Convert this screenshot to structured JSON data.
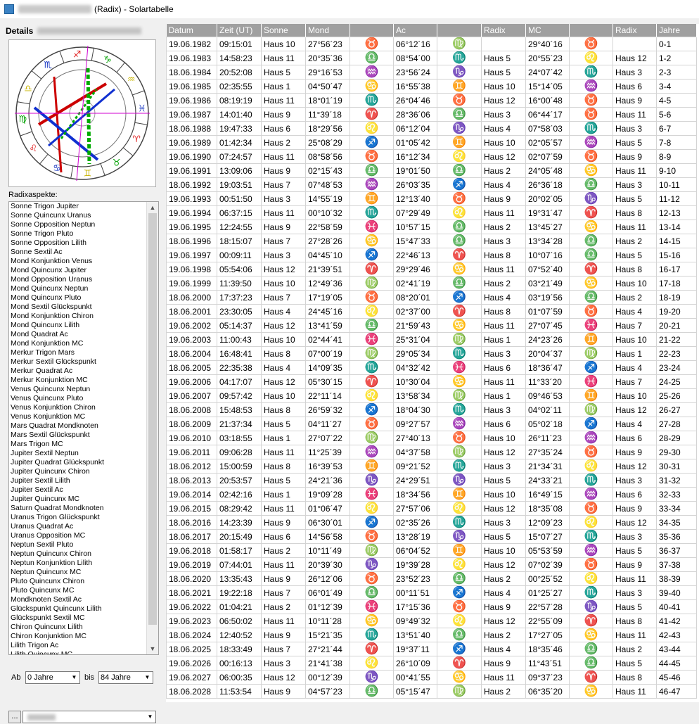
{
  "window": {
    "title": "(Radix) - Solartabelle"
  },
  "left": {
    "details_label": "Details",
    "aspects_label": "Radixaspekte:",
    "aspects": [
      "Sonne Trigon Jupiter",
      "Sonne Quincunx Uranus",
      "Sonne Opposition Neptun",
      "Sonne Trigon Pluto",
      "Sonne Opposition Lilith",
      "Sonne Sextil Ac",
      "Mond Konjunktion Venus",
      "Mond Quincunx Jupiter",
      "Mond Opposition Uranus",
      "Mond Quincunx Neptun",
      "Mond Quincunx Pluto",
      "Mond Sextil Glückspunkt",
      "Mond Konjunktion Chiron",
      "Mond Quincunx Lilith",
      "Mond Quadrat Ac",
      "Mond Konjunktion MC",
      "Merkur Trigon Mars",
      "Merkur Sextil Glückspunkt",
      "Merkur Quadrat Ac",
      "Merkur Konjunktion MC",
      "Venus Quincunx Neptun",
      "Venus Quincunx Pluto",
      "Venus Konjunktion Chiron",
      "Venus Konjunktion MC",
      "Mars Quadrat Mondknoten",
      "Mars Sextil Glückspunkt",
      "Mars Trigon MC",
      "Jupiter Sextil Neptun",
      "Jupiter Quadrat Glückspunkt",
      "Jupiter Quincunx Chiron",
      "Jupiter Sextil Lilith",
      "Jupiter Sextil Ac",
      "Jupiter Quincunx MC",
      "Saturn Quadrat Mondknoten",
      "Uranus Trigon Glückspunkt",
      "Uranus Quadrat Ac",
      "Uranus Opposition MC",
      "Neptun Sextil Pluto",
      "Neptun Quincunx Chiron",
      "Neptun Konjunktion Lilith",
      "Neptun Quincunx MC",
      "Pluto Quincunx Chiron",
      "Pluto Quincunx MC",
      "Mondknoten Sextil Ac",
      "Glückspunkt Quincunx Lilith",
      "Glückspunkt Sextil MC",
      "Chiron Quincunx Lilith",
      "Chiron Konjunktion MC",
      "Lilith Trigon Ac",
      "Lilith Quincunx MC"
    ],
    "range": {
      "from_label": "Ab",
      "from_value": "0 Jahre",
      "to_label": "bis",
      "to_value": "84 Jahre"
    },
    "place_button": "..."
  },
  "colors": {
    "header_bg": "#a0a0a0",
    "fire": "#e02020",
    "earth": "#00a000",
    "air": "#c8b400",
    "water": "#1030c0"
  },
  "table": {
    "columns": [
      "Datum",
      "Zeit (UT)",
      "Sonne",
      "Mond",
      "",
      "Ac",
      "",
      "Radix",
      "MC",
      "",
      "Radix",
      "Jahre"
    ],
    "rows": [
      [
        "19.06.1982",
        "09:15:01",
        "Haus 10",
        "27°56´23",
        "♉",
        "06°12´16",
        "♍",
        "",
        "29°40´16",
        "♉",
        "",
        "0-1"
      ],
      [
        "19.06.1983",
        "14:58:23",
        "Haus 11",
        "20°35´36",
        "♎",
        "08°54´00",
        "♏",
        "Haus 5",
        "20°55´23",
        "♌",
        "Haus 12",
        "1-2"
      ],
      [
        "18.06.1984",
        "20:52:08",
        "Haus 5",
        "29°16´53",
        "♒",
        "23°56´24",
        "♑",
        "Haus 5",
        "24°07´42",
        "♏",
        "Haus 3",
        "2-3"
      ],
      [
        "19.06.1985",
        "02:35:55",
        "Haus 1",
        "04°50´47",
        "♋",
        "16°55´38",
        "♊",
        "Haus 10",
        "15°14´05",
        "♒",
        "Haus 6",
        "3-4"
      ],
      [
        "19.06.1986",
        "08:19:19",
        "Haus 11",
        "18°01´19",
        "♏",
        "26°04´46",
        "♉",
        "Haus 12",
        "16°00´48",
        "♉",
        "Haus 9",
        "4-5"
      ],
      [
        "19.06.1987",
        "14:01:40",
        "Haus 9",
        "11°39´18",
        "♈",
        "28°36´06",
        "♎",
        "Haus 3",
        "06°44´17",
        "♉",
        "Haus 11",
        "5-6"
      ],
      [
        "18.06.1988",
        "19:47:33",
        "Haus 6",
        "18°29´56",
        "♌",
        "06°12´04",
        "♑",
        "Haus 4",
        "07°58´03",
        "♏",
        "Haus 3",
        "6-7"
      ],
      [
        "19.06.1989",
        "01:42:34",
        "Haus 2",
        "25°08´29",
        "♐",
        "01°05´42",
        "♊",
        "Haus 10",
        "02°05´57",
        "♒",
        "Haus 5",
        "7-8"
      ],
      [
        "19.06.1990",
        "07:24:57",
        "Haus 11",
        "08°58´56",
        "♉",
        "16°12´34",
        "♌",
        "Haus 12",
        "02°07´59",
        "♉",
        "Haus 9",
        "8-9"
      ],
      [
        "19.06.1991",
        "13:09:06",
        "Haus 9",
        "02°15´43",
        "♎",
        "19°01´50",
        "♎",
        "Haus 2",
        "24°05´48",
        "♋",
        "Haus 11",
        "9-10"
      ],
      [
        "18.06.1992",
        "19:03:51",
        "Haus 7",
        "07°48´53",
        "♒",
        "26°03´35",
        "♐",
        "Haus 4",
        "26°36´18",
        "♎",
        "Haus 3",
        "10-11"
      ],
      [
        "19.06.1993",
        "00:51:50",
        "Haus 3",
        "14°55´19",
        "♊",
        "12°13´40",
        "♉",
        "Haus 9",
        "20°02´05",
        "♑",
        "Haus 5",
        "11-12"
      ],
      [
        "19.06.1994",
        "06:37:15",
        "Haus 11",
        "00°10´32",
        "♏",
        "07°29´49",
        "♌",
        "Haus 11",
        "19°31´47",
        "♈",
        "Haus 8",
        "12-13"
      ],
      [
        "19.06.1995",
        "12:24:55",
        "Haus 9",
        "22°58´59",
        "♓",
        "10°57´15",
        "♎",
        "Haus 2",
        "13°45´27",
        "♋",
        "Haus 11",
        "13-14"
      ],
      [
        "18.06.1996",
        "18:15:07",
        "Haus 7",
        "27°28´26",
        "♋",
        "15°47´33",
        "♎",
        "Haus 3",
        "13°34´28",
        "♎",
        "Haus 2",
        "14-15"
      ],
      [
        "19.06.1997",
        "00:09:11",
        "Haus 3",
        "04°45´10",
        "♐",
        "22°46´13",
        "♈",
        "Haus 8",
        "10°07´16",
        "♎",
        "Haus 5",
        "15-16"
      ],
      [
        "19.06.1998",
        "05:54:06",
        "Haus 12",
        "21°39´51",
        "♈",
        "29°29´46",
        "♋",
        "Haus 11",
        "07°52´40",
        "♈",
        "Haus 8",
        "16-17"
      ],
      [
        "19.06.1999",
        "11:39:50",
        "Haus 10",
        "12°49´36",
        "♍",
        "02°41´19",
        "♎",
        "Haus 2",
        "03°21´49",
        "♋",
        "Haus 10",
        "17-18"
      ],
      [
        "18.06.2000",
        "17:37:23",
        "Haus 7",
        "17°19´05",
        "♉",
        "08°20´01",
        "♐",
        "Haus 4",
        "03°19´56",
        "♎",
        "Haus 2",
        "18-19"
      ],
      [
        "18.06.2001",
        "23:30:05",
        "Haus 4",
        "24°45´16",
        "♌",
        "02°37´00",
        "♈",
        "Haus 8",
        "01°07´59",
        "♉",
        "Haus 4",
        "19-20"
      ],
      [
        "19.06.2002",
        "05:14:37",
        "Haus 12",
        "13°41´59",
        "♎",
        "21°59´43",
        "♋",
        "Haus 11",
        "27°07´45",
        "♓",
        "Haus 7",
        "20-21"
      ],
      [
        "19.06.2003",
        "11:00:43",
        "Haus 10",
        "02°44´41",
        "♓",
        "25°31´04",
        "♍",
        "Haus 1",
        "24°23´26",
        "♊",
        "Haus 10",
        "21-22"
      ],
      [
        "18.06.2004",
        "16:48:41",
        "Haus 8",
        "07°00´19",
        "♍",
        "29°05´34",
        "♏",
        "Haus 3",
        "20°04´37",
        "♍",
        "Haus 1",
        "22-23"
      ],
      [
        "18.06.2005",
        "22:35:38",
        "Haus 4",
        "14°09´35",
        "♏",
        "04°32´42",
        "♓",
        "Haus 6",
        "18°36´47",
        "♐",
        "Haus 4",
        "23-24"
      ],
      [
        "19.06.2006",
        "04:17:07",
        "Haus 12",
        "05°30´15",
        "♈",
        "10°30´04",
        "♋",
        "Haus 11",
        "11°33´20",
        "♓",
        "Haus 7",
        "24-25"
      ],
      [
        "19.06.2007",
        "09:57:42",
        "Haus 10",
        "22°11´14",
        "♌",
        "13°58´34",
        "♍",
        "Haus 1",
        "09°46´53",
        "♊",
        "Haus 10",
        "25-26"
      ],
      [
        "18.06.2008",
        "15:48:53",
        "Haus 8",
        "26°59´32",
        "♐",
        "18°04´30",
        "♏",
        "Haus 3",
        "04°02´11",
        "♍",
        "Haus 12",
        "26-27"
      ],
      [
        "18.06.2009",
        "21:37:34",
        "Haus 5",
        "04°11´27",
        "♉",
        "09°27´57",
        "♒",
        "Haus 6",
        "05°02´18",
        "♐",
        "Haus 4",
        "27-28"
      ],
      [
        "19.06.2010",
        "03:18:55",
        "Haus 1",
        "27°07´22",
        "♍",
        "27°40´13",
        "♉",
        "Haus 10",
        "26°11´23",
        "♒",
        "Haus 6",
        "28-29"
      ],
      [
        "19.06.2011",
        "09:06:28",
        "Haus 11",
        "11°25´39",
        "♒",
        "04°37´58",
        "♍",
        "Haus 12",
        "27°35´24",
        "♉",
        "Haus 9",
        "29-30"
      ],
      [
        "18.06.2012",
        "15:00:59",
        "Haus 8",
        "16°39´53",
        "♊",
        "09°21´52",
        "♏",
        "Haus 3",
        "21°34´31",
        "♌",
        "Haus 12",
        "30-31"
      ],
      [
        "18.06.2013",
        "20:53:57",
        "Haus 5",
        "24°21´36",
        "♑",
        "24°29´51",
        "♑",
        "Haus 5",
        "24°33´21",
        "♏",
        "Haus 3",
        "31-32"
      ],
      [
        "19.06.2014",
        "02:42:16",
        "Haus 1",
        "19°09´28",
        "♓",
        "18°34´56",
        "♊",
        "Haus 10",
        "16°49´15",
        "♒",
        "Haus 6",
        "32-33"
      ],
      [
        "19.06.2015",
        "08:29:42",
        "Haus 11",
        "01°06´47",
        "♌",
        "27°57´06",
        "♌",
        "Haus 12",
        "18°35´08",
        "♉",
        "Haus 9",
        "33-34"
      ],
      [
        "18.06.2016",
        "14:23:39",
        "Haus 9",
        "06°30´01",
        "♐",
        "02°35´26",
        "♏",
        "Haus 3",
        "12°09´23",
        "♌",
        "Haus 12",
        "34-35"
      ],
      [
        "18.06.2017",
        "20:15:49",
        "Haus 6",
        "14°56´58",
        "♉",
        "13°28´19",
        "♑",
        "Haus 5",
        "15°07´27",
        "♏",
        "Haus 3",
        "35-36"
      ],
      [
        "19.06.2018",
        "01:58:17",
        "Haus 2",
        "10°11´49",
        "♍",
        "06°04´52",
        "♊",
        "Haus 10",
        "05°53´59",
        "♒",
        "Haus 5",
        "36-37"
      ],
      [
        "19.06.2019",
        "07:44:01",
        "Haus 11",
        "20°39´30",
        "♑",
        "19°39´28",
        "♌",
        "Haus 12",
        "07°02´39",
        "♉",
        "Haus 9",
        "37-38"
      ],
      [
        "18.06.2020",
        "13:35:43",
        "Haus 9",
        "26°12´06",
        "♉",
        "23°52´23",
        "♎",
        "Haus 2",
        "00°25´52",
        "♌",
        "Haus 11",
        "38-39"
      ],
      [
        "18.06.2021",
        "19:22:18",
        "Haus 7",
        "06°01´49",
        "♎",
        "00°11´51",
        "♐",
        "Haus 4",
        "01°25´27",
        "♏",
        "Haus 3",
        "39-40"
      ],
      [
        "19.06.2022",
        "01:04:21",
        "Haus 2",
        "01°12´39",
        "♓",
        "17°15´36",
        "♉",
        "Haus 9",
        "22°57´28",
        "♑",
        "Haus 5",
        "40-41"
      ],
      [
        "19.06.2023",
        "06:50:02",
        "Haus 11",
        "10°11´28",
        "♋",
        "09°49´32",
        "♌",
        "Haus 12",
        "22°55´09",
        "♈",
        "Haus 8",
        "41-42"
      ],
      [
        "18.06.2024",
        "12:40:52",
        "Haus 9",
        "15°21´35",
        "♏",
        "13°51´40",
        "♎",
        "Haus 2",
        "17°27´05",
        "♋",
        "Haus 11",
        "42-43"
      ],
      [
        "18.06.2025",
        "18:33:49",
        "Haus 7",
        "27°21´44",
        "♈",
        "19°37´11",
        "♐",
        "Haus 4",
        "18°35´46",
        "♎",
        "Haus 2",
        "43-44"
      ],
      [
        "19.06.2026",
        "00:16:13",
        "Haus 3",
        "21°41´38",
        "♌",
        "26°10´09",
        "♈",
        "Haus 9",
        "11°43´51",
        "♎",
        "Haus 5",
        "44-45"
      ],
      [
        "19.06.2027",
        "06:00:35",
        "Haus 12",
        "00°12´39",
        "♑",
        "00°41´55",
        "♋",
        "Haus 11",
        "09°37´23",
        "♈",
        "Haus 8",
        "45-46"
      ],
      [
        "18.06.2028",
        "11:53:54",
        "Haus 9",
        "04°57´23",
        "♎",
        "05°15´47",
        "♍",
        "Haus 2",
        "06°35´20",
        "♋",
        "Haus 11",
        "46-47"
      ]
    ]
  }
}
